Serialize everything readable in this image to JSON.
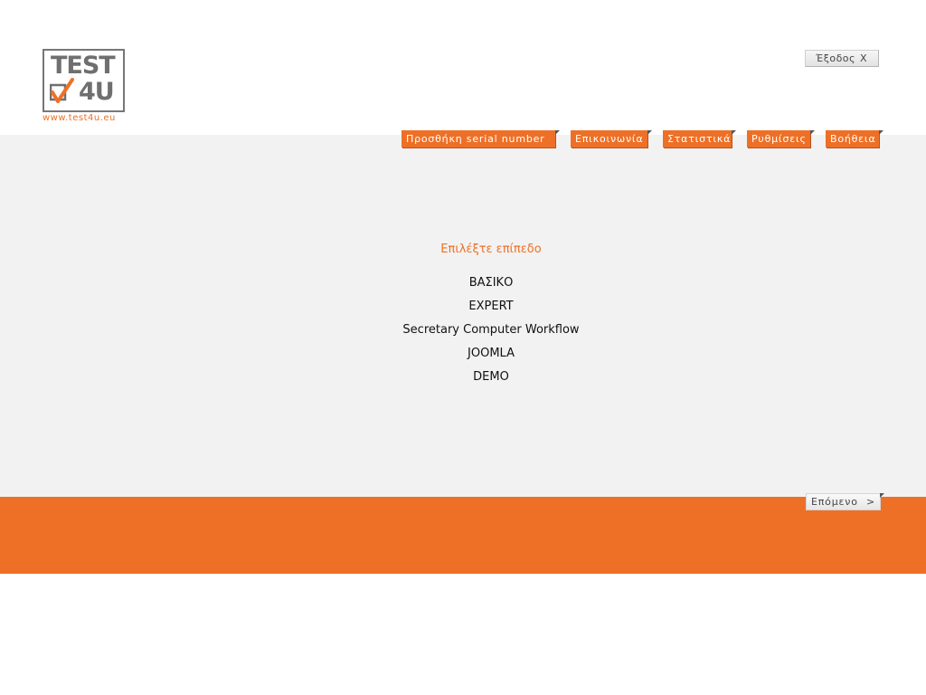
{
  "header": {
    "logo_line1": "TEST",
    "logo_line2": "4U",
    "logo_url": "www.test4u.eu",
    "exit_label": "Έξοδος",
    "exit_icon": "X"
  },
  "nav": {
    "items": [
      {
        "label": "Προσθήκη serial number"
      },
      {
        "label": "Επικοινωνία"
      },
      {
        "label": "Στατιστικά"
      },
      {
        "label": "Ρυθμίσεις"
      },
      {
        "label": "Βοήθεια"
      }
    ]
  },
  "main": {
    "title": "Επιλέξτε επίπεδο",
    "levels": [
      "ΒΑΣΙΚΟ",
      "EXPERT",
      "Secretary Computer Workflow",
      "JOOMLA",
      "DEMO"
    ]
  },
  "footer": {
    "next_label": "Επόμενο",
    "next_icon": ">"
  },
  "colors": {
    "accent": "#ee7026",
    "band": "#f2f2f2",
    "logo_gray": "#6f6f6f"
  }
}
